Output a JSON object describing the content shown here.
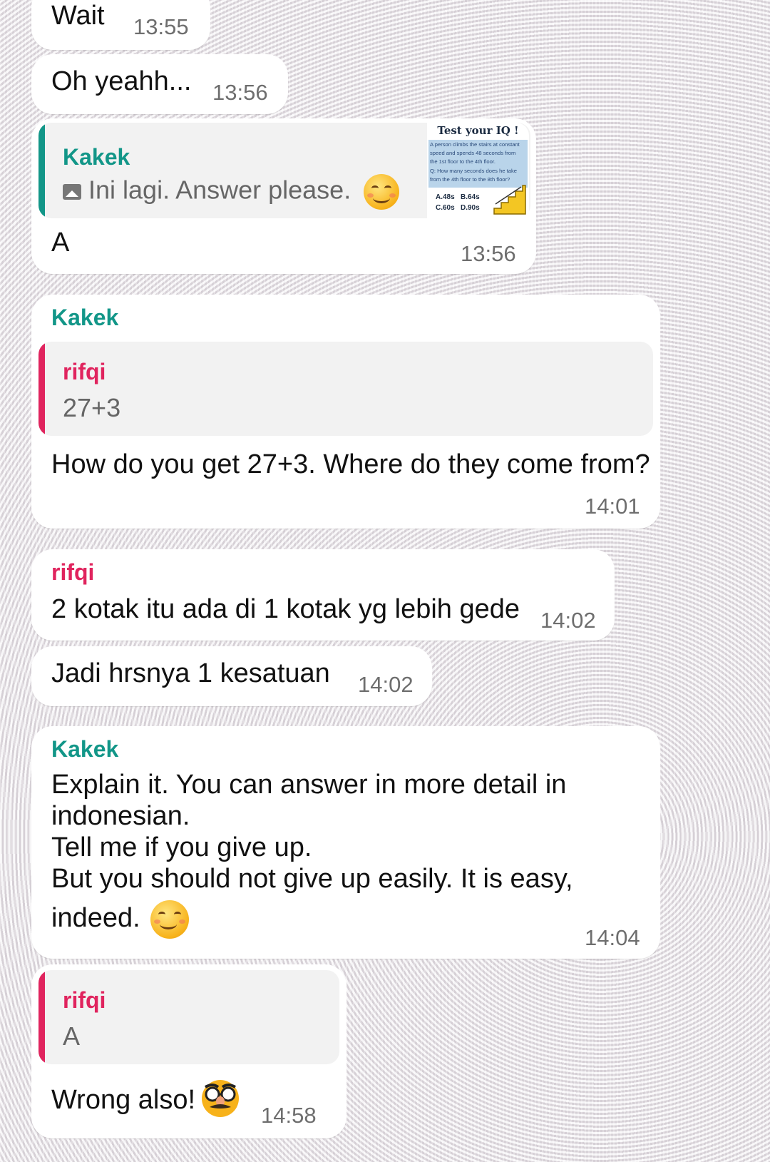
{
  "messages": {
    "m1": {
      "text": "Wait",
      "time": "13:55"
    },
    "m2": {
      "text": "Oh yeahh...",
      "time": "13:56"
    },
    "m3": {
      "quote_sender": "Kakek",
      "quote_text": "Ini lagi. Answer please.",
      "thumbnail": {
        "title": "Test your IQ !",
        "lines": [
          "A person climbs the stairs at constant",
          "speed and spends 48 seconds from",
          "the 1st floor to the 4th floor.",
          "Q: How many seconds does he take",
          "from the 4th floor to the 8th floor?"
        ],
        "answers": [
          "A.48s",
          "B.64s",
          "C.60s",
          "D.90s"
        ]
      },
      "text": "A",
      "time": "13:56"
    },
    "m4": {
      "sender": "Kakek",
      "quote_sender": "rifqi",
      "quote_text": "27+3",
      "text": "How do you get 27+3. Where do they come from?",
      "time": "14:01"
    },
    "m5": {
      "sender": "rifqi",
      "text": "2 kotak itu ada di 1 kotak yg lebih gede",
      "time": "14:02"
    },
    "m6": {
      "text": "Jadi hrsnya 1 kesatuan",
      "time": "14:02"
    },
    "m7": {
      "sender": "Kakek",
      "lines": [
        "Explain it. You can answer in more detail in",
        "indonesian.",
        "Tell me if you give up.",
        "But you should not give up easily. It is easy,",
        "indeed."
      ],
      "time": "14:04"
    },
    "m8": {
      "quote_sender": "rifqi",
      "quote_text": "A",
      "text": "Wrong also!",
      "time": "14:58"
    }
  },
  "colors": {
    "kakek": "#129688",
    "rifqi": "#e0245e",
    "bubble": "#ffffff"
  },
  "icons": [
    "image-icon",
    "smiling-face-emoji",
    "disguised-face-emoji"
  ]
}
